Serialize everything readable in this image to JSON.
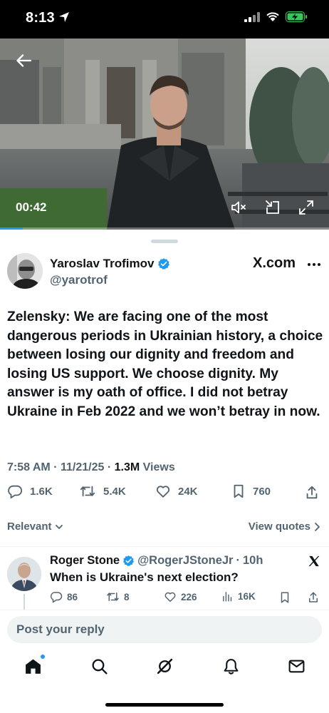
{
  "status_bar": {
    "time": "8:13"
  },
  "video": {
    "elapsed": "00:42",
    "progress_fraction": 0.07
  },
  "tweet": {
    "author_name": "Yaroslav Trofimov",
    "author_handle": "@yarotrof",
    "source": "X.com",
    "text": "Zelensky: We are facing one of the most dangerous periods in Ukrainian history, a choice between losing our dignity and freedom and losing US support. We choose dignity. My answer is my oath of office. I did not betray Ukraine in Feb 2022 and we won’t betray in now.",
    "time": "7:58 AM",
    "date": "11/21/25",
    "views_count": "1.3M",
    "views_label": "Views",
    "replies": "1.6K",
    "reposts": "5.4K",
    "likes": "24K",
    "bookmarks": "760"
  },
  "filters": {
    "sort_label": "Relevant",
    "quotes_label": "View quotes"
  },
  "reply": {
    "author_name": "Roger Stone",
    "author_handle": "@RogerJStoneJr",
    "age": "10h",
    "text": "When is Ukraine's next election?",
    "replies": "86",
    "reposts": "8",
    "likes": "226",
    "views": "16K"
  },
  "composer": {
    "placeholder": "Post your reply"
  },
  "colors": {
    "accent": "#1d9bf0",
    "verified": "#1d9bf0",
    "text": "#0f1419",
    "muted": "#536471"
  },
  "icons": [
    "location-arrow-icon",
    "signal-icon",
    "wifi-icon",
    "battery-icon",
    "back-arrow-icon",
    "mute-icon",
    "pip-icon",
    "fullscreen-icon",
    "verified-badge-icon",
    "more-icon",
    "reply-icon",
    "repost-icon",
    "like-icon",
    "bookmark-icon",
    "share-icon",
    "chevron-down-icon",
    "chevron-right-icon",
    "x-logo-icon",
    "views-icon",
    "home-icon",
    "search-icon",
    "grok-icon",
    "notifications-icon",
    "messages-icon"
  ]
}
